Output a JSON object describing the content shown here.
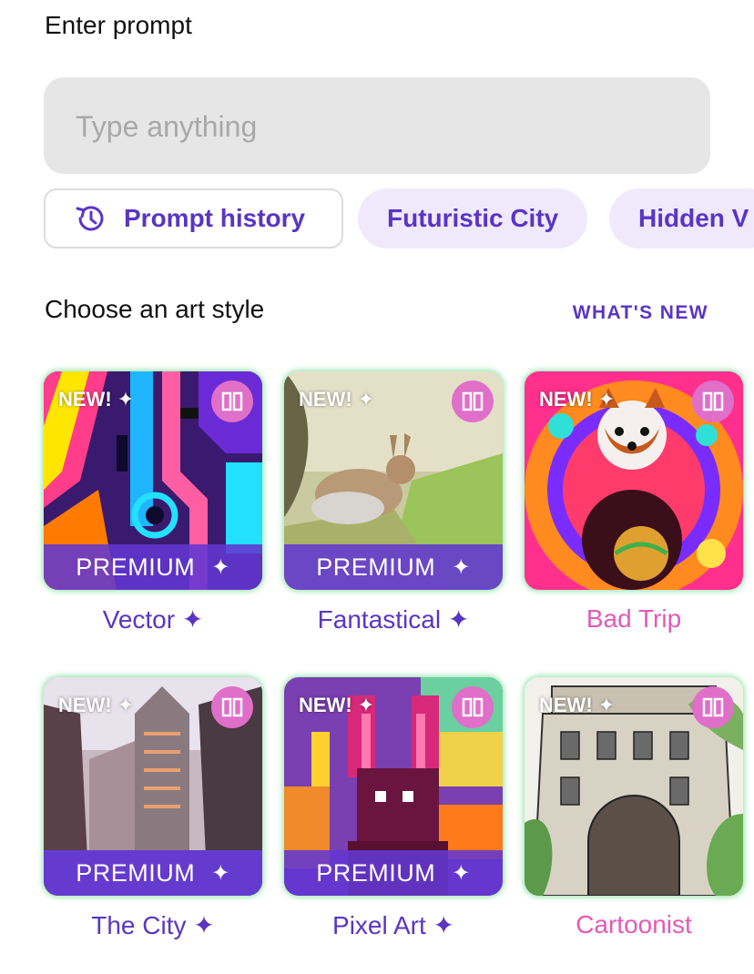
{
  "prompt": {
    "label": "Enter prompt",
    "placeholder": "Type anything",
    "value": ""
  },
  "chips": {
    "history_label": "Prompt history",
    "suggestions": [
      "Futuristic City",
      "Hidden V"
    ]
  },
  "styles_section": {
    "title": "Choose an art style",
    "whats_new": "WHAT'S NEW",
    "premium_label": "PREMIUM",
    "new_badge": "NEW!",
    "spark": "✦",
    "cards": [
      {
        "name": "Vector ✦",
        "premium": true,
        "new": true
      },
      {
        "name": "Fantastical ✦",
        "premium": true,
        "new": true
      },
      {
        "name": "Bad Trip",
        "premium": false,
        "new": true
      },
      {
        "name": "The City ✦",
        "premium": true,
        "new": true
      },
      {
        "name": "Pixel Art ✦",
        "premium": true,
        "new": true
      },
      {
        "name": "Cartoonist",
        "premium": false,
        "new": true
      }
    ]
  },
  "colors": {
    "accent": "#5a35c4",
    "pink_label": "#e05bb8",
    "chip_bg": "#efe9fb",
    "input_bg": "#e6e6e6"
  }
}
